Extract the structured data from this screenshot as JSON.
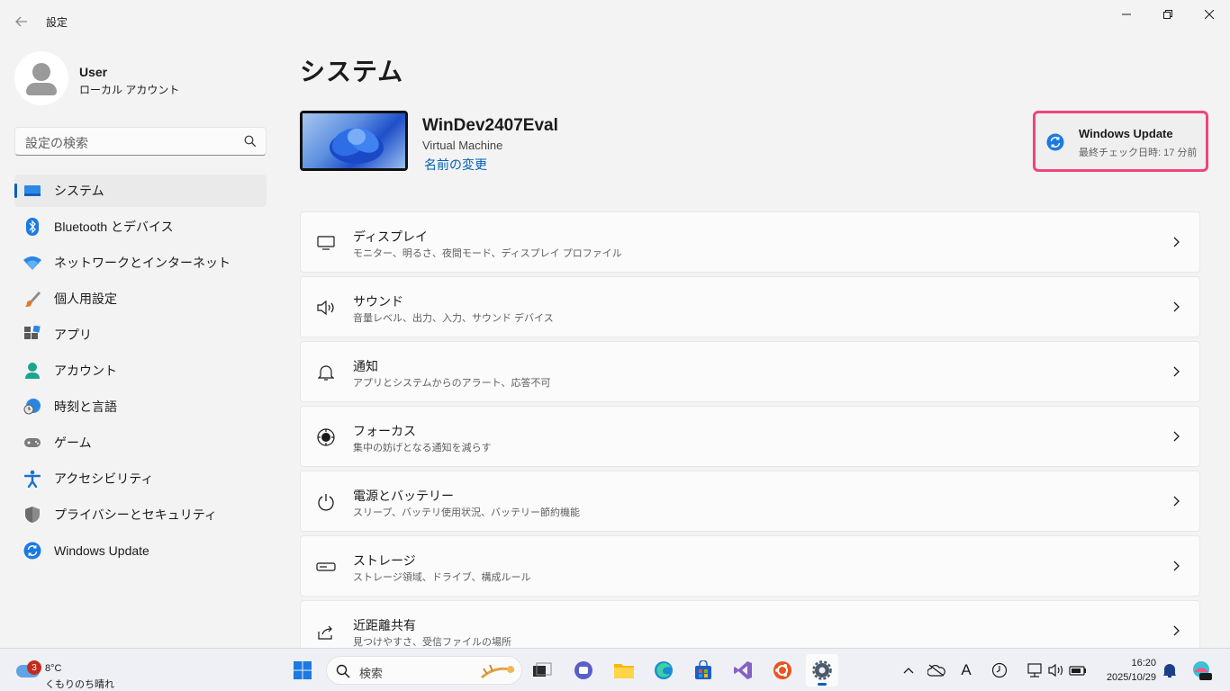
{
  "window": {
    "title": "設定"
  },
  "user": {
    "name": "User",
    "account_type": "ローカル アカウント"
  },
  "sidebar": {
    "search_placeholder": "設定の検索",
    "items": [
      {
        "label": "システム",
        "icon": "system-icon",
        "active": true
      },
      {
        "label": "Bluetooth とデバイス",
        "icon": "bluetooth-icon"
      },
      {
        "label": "ネットワークとインターネット",
        "icon": "wifi-icon"
      },
      {
        "label": "個人用設定",
        "icon": "brush-icon"
      },
      {
        "label": "アプリ",
        "icon": "apps-icon"
      },
      {
        "label": "アカウント",
        "icon": "person-icon"
      },
      {
        "label": "時刻と言語",
        "icon": "globe-clock-icon"
      },
      {
        "label": "ゲーム",
        "icon": "gamepad-icon"
      },
      {
        "label": "アクセシビリティ",
        "icon": "accessibility-icon"
      },
      {
        "label": "プライバシーとセキュリティ",
        "icon": "shield-icon"
      },
      {
        "label": "Windows Update",
        "icon": "update-icon"
      }
    ]
  },
  "main": {
    "title": "システム",
    "device": {
      "name": "WinDev2407Eval",
      "type": "Virtual Machine",
      "rename_label": "名前の変更"
    },
    "windows_update": {
      "title": "Windows Update",
      "subtitle": "最終チェック日時: 17 分前"
    },
    "cards": [
      {
        "title": "ディスプレイ",
        "subtitle": "モニター、明るさ、夜間モード、ディスプレイ プロファイル",
        "icon": "display-icon"
      },
      {
        "title": "サウンド",
        "subtitle": "音量レベル、出力、入力、サウンド デバイス",
        "icon": "speaker-icon"
      },
      {
        "title": "通知",
        "subtitle": "アプリとシステムからのアラート、応答不可",
        "icon": "bell-icon"
      },
      {
        "title": "フォーカス",
        "subtitle": "集中の妨げとなる通知を減らす",
        "icon": "focus-icon"
      },
      {
        "title": "電源とバッテリー",
        "subtitle": "スリープ、バッテリ使用状況、バッテリー節約機能",
        "icon": "power-icon"
      },
      {
        "title": "ストレージ",
        "subtitle": "ストレージ領域、ドライブ、構成ルール",
        "icon": "storage-icon"
      },
      {
        "title": "近距離共有",
        "subtitle": "見つけやすさ、受信ファイルの場所",
        "icon": "share-icon"
      }
    ]
  },
  "taskbar": {
    "weather": {
      "temp": "8°C",
      "condition": "くもりのち晴れ",
      "badge": "3"
    },
    "search_label": "検索",
    "clock": {
      "time": "16:20",
      "date": "2025/10/29"
    },
    "tray_letter": "A"
  },
  "colors": {
    "accent": "#005fb8",
    "highlight_border": "#f0447a"
  }
}
